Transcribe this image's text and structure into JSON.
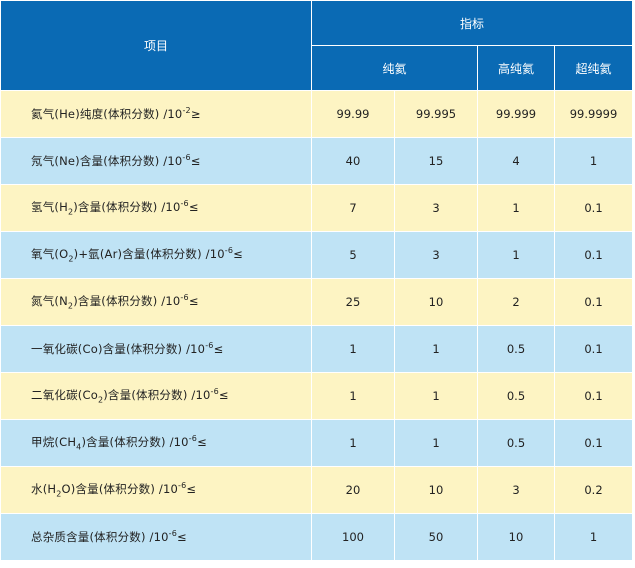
{
  "header": {
    "item_label": "项目",
    "indicator_label": "指标",
    "grade_pure": "纯氦",
    "grade_high": "高纯氦",
    "grade_ultra": "超纯氦"
  },
  "rows": [
    {
      "pre": "氦气(He)纯度(体积分数) /10",
      "exp": "-2",
      "post": "≥",
      "values": [
        "99.99",
        "99.995",
        "99.999",
        "99.9999"
      ]
    },
    {
      "pre": "氖气(Ne)含量(体积分数) /10",
      "exp": "-6",
      "post": "≤",
      "values": [
        "40",
        "15",
        "4",
        "1"
      ]
    },
    {
      "pre": "氢气(H",
      "sub": "2",
      "mid": ")含量(体积分数) /10",
      "exp": "-6",
      "post": "≤",
      "values": [
        "7",
        "3",
        "1",
        "0.1"
      ]
    },
    {
      "pre": "氧气(O",
      "sub": "2",
      "mid": ")+氩(Ar)含量(体积分数) /10",
      "exp": "-6",
      "post": "≤",
      "values": [
        "5",
        "3",
        "1",
        "0.1"
      ]
    },
    {
      "pre": "氮气(N",
      "sub": "2",
      "mid": ")含量(体积分数) /10",
      "exp": "-6",
      "post": "≤",
      "values": [
        "25",
        "10",
        "2",
        "0.1"
      ]
    },
    {
      "pre": "一氧化碳(Co)含量(体积分数) /10",
      "exp": "-6",
      "post": "≤",
      "values": [
        "1",
        "1",
        "0.5",
        "0.1"
      ]
    },
    {
      "pre": "二氧化碳(Co",
      "sub": "2",
      "mid": ")含量(体积分数) /10",
      "exp": "-6",
      "post": "≤",
      "values": [
        "1",
        "1",
        "0.5",
        "0.1"
      ]
    },
    {
      "pre": "甲烷(CH",
      "sub": "4",
      "mid": ")含量(体积分数) /10",
      "exp": "-6",
      "post": "≤",
      "values": [
        "1",
        "1",
        "0.5",
        "0.1"
      ]
    },
    {
      "pre": "水(H",
      "sub": "2",
      "mid": "O)含量(体积分数) /10",
      "exp": "-6",
      "post": "≤",
      "values": [
        "20",
        "10",
        "3",
        "0.2"
      ]
    },
    {
      "pre": "总杂质含量(体积分数) /10",
      "exp": "-6",
      "post": "≤",
      "values": [
        "100",
        "50",
        "10",
        "1"
      ]
    }
  ]
}
